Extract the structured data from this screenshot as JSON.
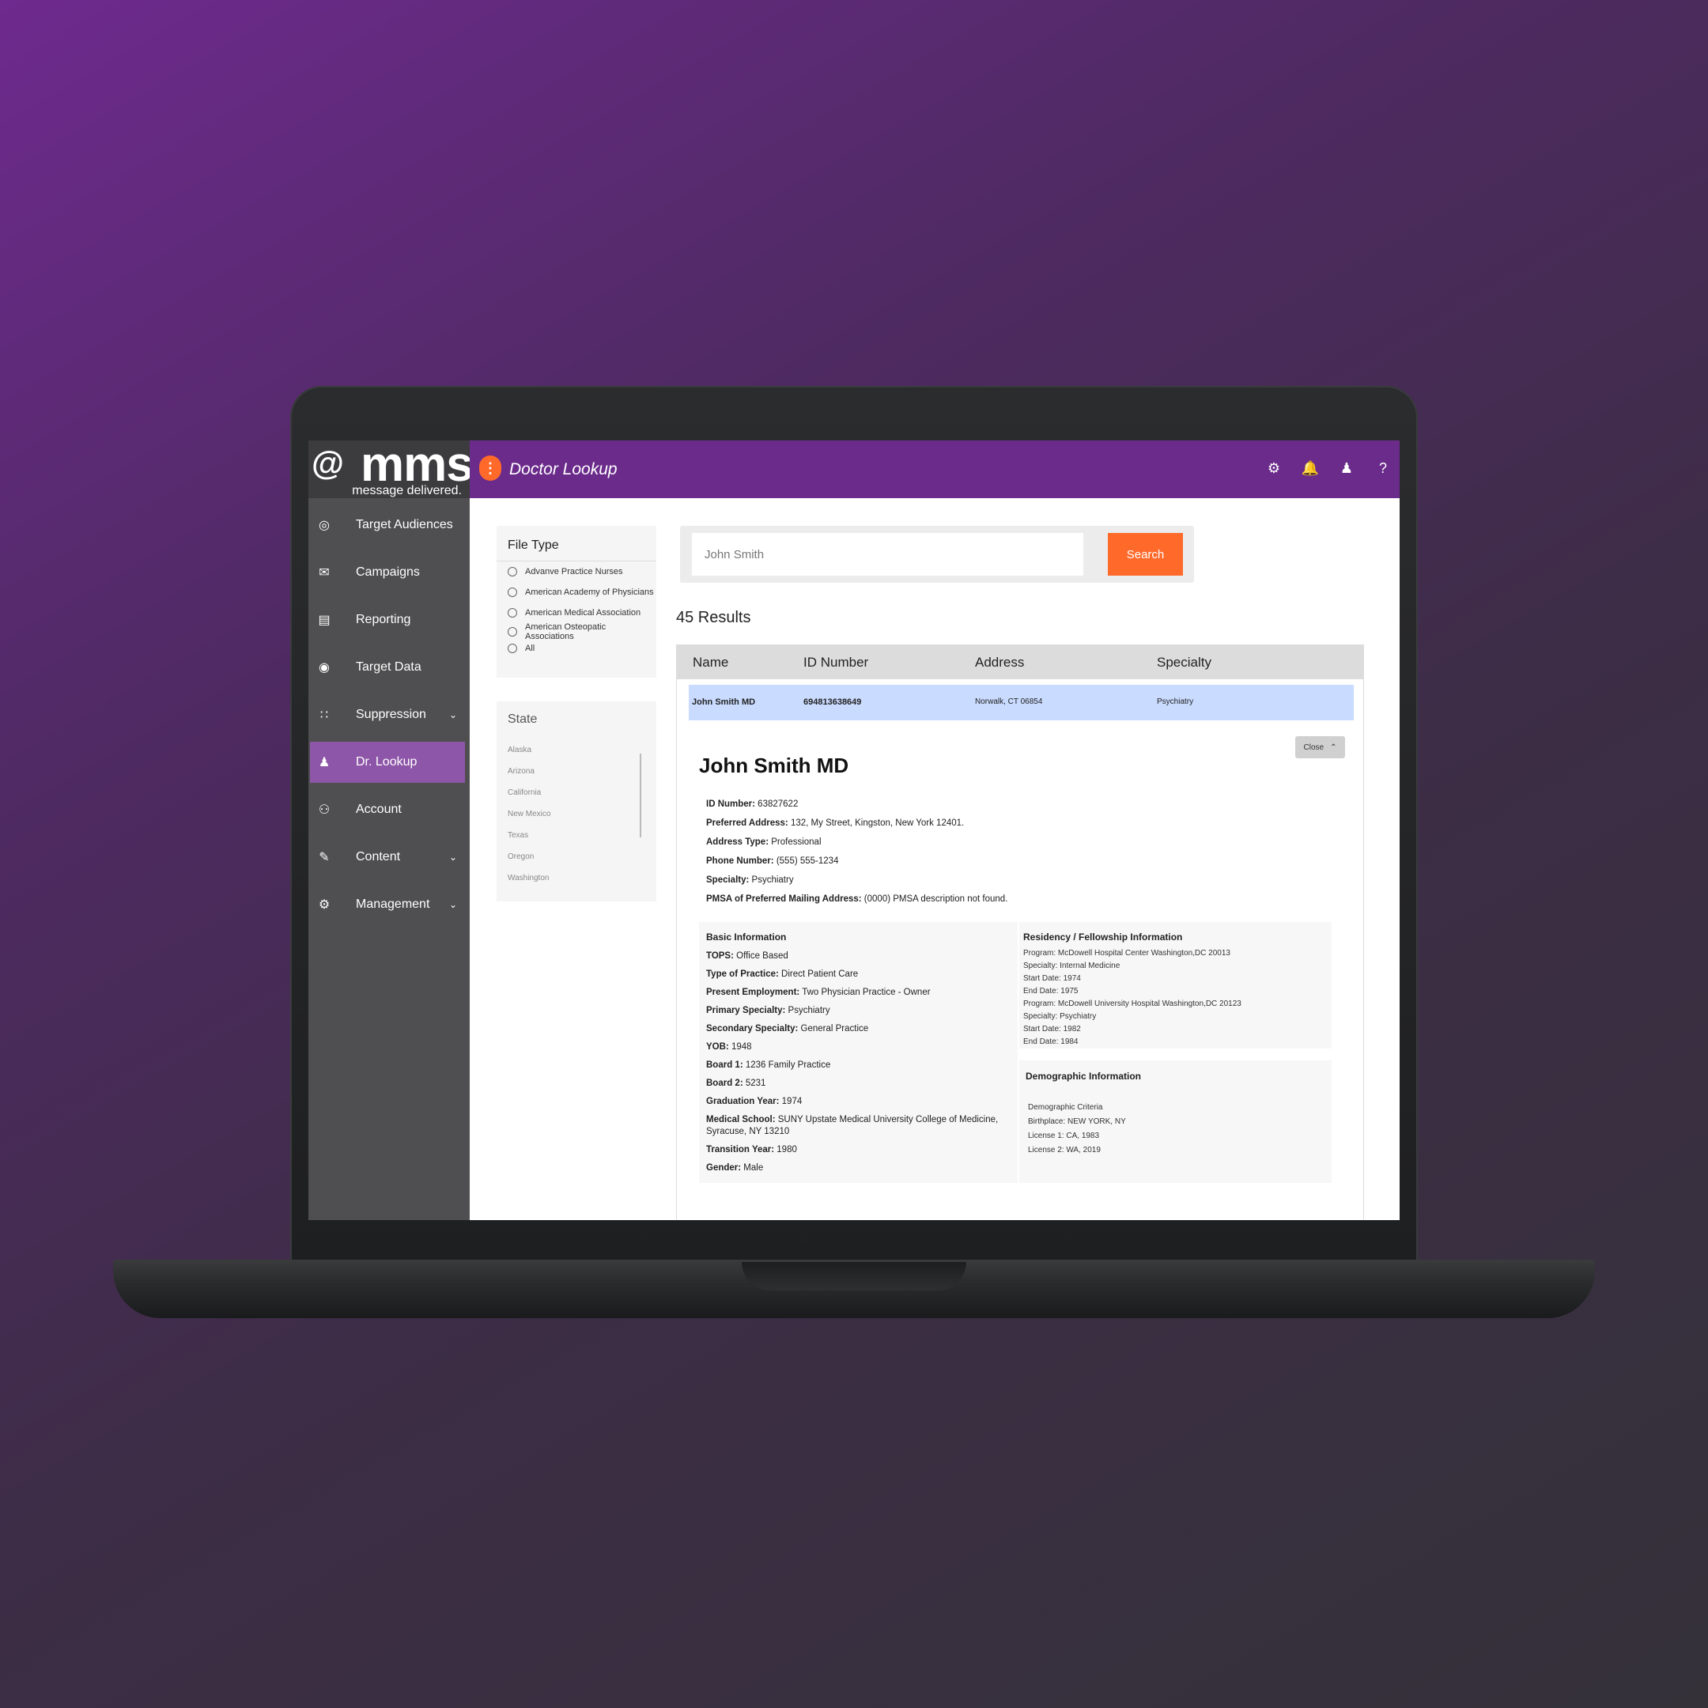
{
  "sidebar": {
    "logo_text": "mms",
    "logo_icon": "@",
    "logo_tagline": "message delivered.",
    "items": [
      {
        "label": "Target Audiences",
        "icon": "target-icon",
        "has_chevron": false,
        "active": false
      },
      {
        "label": "Campaigns",
        "icon": "mail-icon",
        "has_chevron": false,
        "active": false
      },
      {
        "label": "Reporting",
        "icon": "chart-icon",
        "has_chevron": false,
        "active": false
      },
      {
        "label": "Target Data",
        "icon": "bullseye-icon",
        "has_chevron": false,
        "active": false
      },
      {
        "label": "Suppression",
        "icon": "grid-people-icon",
        "has_chevron": true,
        "active": false
      },
      {
        "label": "Dr. Lookup",
        "icon": "doctor-icon",
        "has_chevron": false,
        "active": true
      },
      {
        "label": "Account",
        "icon": "users-icon",
        "has_chevron": false,
        "active": false
      },
      {
        "label": "Content",
        "icon": "content-icon",
        "has_chevron": true,
        "active": false
      },
      {
        "label": "Management",
        "icon": "management-icon",
        "has_chevron": true,
        "active": false
      }
    ]
  },
  "header": {
    "title": "Doctor Lookup",
    "icons": [
      "gear-icon",
      "bell-icon",
      "user-icon",
      "help-icon"
    ]
  },
  "filters": {
    "file_type": {
      "title": "File Type",
      "options": [
        "Advanve Practice Nurses",
        "American Academy of Physicians",
        "American Medical Association",
        "American Osteopatic Associations",
        "All"
      ]
    },
    "state": {
      "title": "State",
      "options": [
        "Alaska",
        "Arizona",
        "California",
        "New Mexico",
        "Texas",
        "Oregon",
        "Washington"
      ]
    }
  },
  "search": {
    "value": "John Smith",
    "button_label": "Search"
  },
  "results": {
    "count_label": "45 Results",
    "columns": [
      "Name",
      "ID Number",
      "Address",
      "Specialty"
    ],
    "row": {
      "name": "John Smith MD",
      "id": "694813638649",
      "address": "Norwalk, CT 06854",
      "specialty": "Psychiatry"
    }
  },
  "detail": {
    "close_label": "Close",
    "name": "John Smith MD",
    "info": [
      {
        "label": "ID Number:",
        "value": " 63827622"
      },
      {
        "label": "Preferred Address:",
        "value": " 132, My Street, Kingston, New York 12401."
      },
      {
        "label": "Address Type:",
        "value": " Professional"
      },
      {
        "label": "Phone Number:",
        "value": " (555) 555-1234"
      },
      {
        "label": "Specialty:",
        "value": " Psychiatry"
      },
      {
        "label": "PMSA of Preferred Mailing Address:",
        "value": "  (0000) PMSA description not found."
      }
    ],
    "basic": {
      "title": "Basic Information",
      "lines": [
        {
          "label": "TOPS:",
          "value": " Office Based"
        },
        {
          "label": "Type of Practice:",
          "value": " Direct Patient Care"
        },
        {
          "label": "Present Employment:",
          "value": " Two Physician Practice - Owner"
        },
        {
          "label": "Primary Specialty:",
          "value": " Psychiatry"
        },
        {
          "label": "Secondary Specialty:",
          "value": " General Practice"
        },
        {
          "label": "YOB:",
          "value": " 1948"
        },
        {
          "label": "Board 1:",
          "value": " 1236 Family Practice"
        },
        {
          "label": "Board 2:",
          "value": " 5231"
        },
        {
          "label": "Graduation Year:",
          "value": " 1974"
        },
        {
          "label": "Medical School:",
          "value": " SUNY Upstate Medical University College of Medicine, Syracuse, NY 13210"
        },
        {
          "label": "Transition Year:",
          "value": " 1980"
        },
        {
          "label": "Gender:",
          "value": " Male"
        }
      ]
    },
    "residency": {
      "title": "Residency / Fellowship Information",
      "lines": [
        "Program: McDowell Hospital Center Washington,DC 20013",
        "Specialty: Internal Medicine",
        "Start Date: 1974",
        "End Date: 1975",
        "Program: McDowell University Hospital Washington,DC 20123",
        "Specialty: Psychiatry",
        "Start Date: 1982",
        "End Date: 1984"
      ]
    },
    "demographic": {
      "title": "Demographic Information",
      "lines": [
        "Demographic Criteria",
        "Birthplace: NEW YORK, NY",
        "License 1: CA, 1983",
        "License 2: WA, 2019"
      ]
    }
  }
}
